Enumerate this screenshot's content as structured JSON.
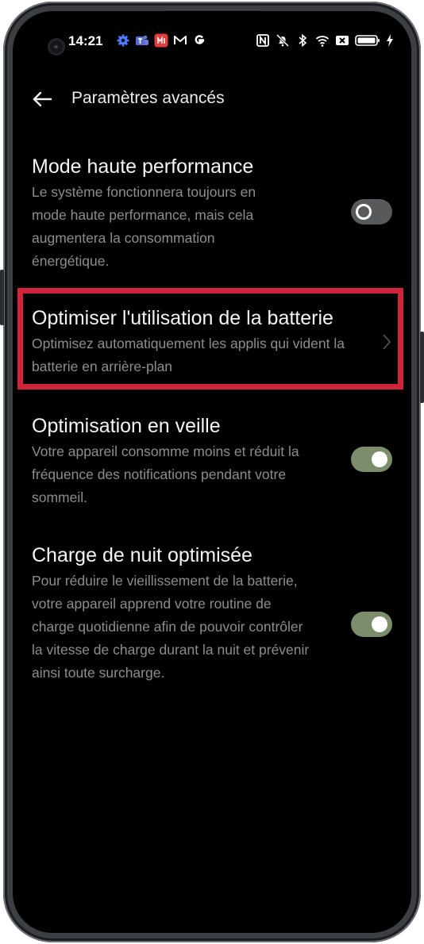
{
  "status_bar": {
    "time": "14:21",
    "left_icons": [
      "settings-gear-icon",
      "teams-icon",
      "office-icon",
      "gmail-icon",
      "google-icon"
    ],
    "right_icons": [
      "nfc-icon",
      "mute-icon",
      "bluetooth-icon",
      "wifi-icon",
      "close-box-icon",
      "battery-icon",
      "charging-icon"
    ]
  },
  "header": {
    "title": "Paramètres avancés"
  },
  "settings": [
    {
      "title": "Mode haute performance",
      "description": "Le système fonctionnera toujours en mode haute performance, mais cela augmentera la consommation énergétique.",
      "control": "toggle",
      "enabled": false
    },
    {
      "title": "Optimiser l'utilisation de la batterie",
      "description": "Optimisez automatiquement les applis qui vident la batterie en arrière-plan",
      "control": "chevron",
      "highlighted": true
    },
    {
      "title": "Optimisation en veille",
      "description": "Votre appareil consomme moins et réduit la fréquence des notifications pendant votre sommeil.",
      "control": "toggle",
      "enabled": true
    },
    {
      "title": "Charge de nuit optimisée",
      "description": "Pour réduire le vieillissement de la batterie, votre appareil apprend votre routine de charge quotidienne afin de pouvoir contrôler la vitesse de charge durant la nuit et prévenir ainsi toute surcharge.",
      "control": "toggle",
      "enabled": true
    }
  ],
  "colors": {
    "highlight": "#d0243a",
    "toggle_on": "#7b8d6a",
    "toggle_off": "#58595b",
    "background": "#000000"
  }
}
